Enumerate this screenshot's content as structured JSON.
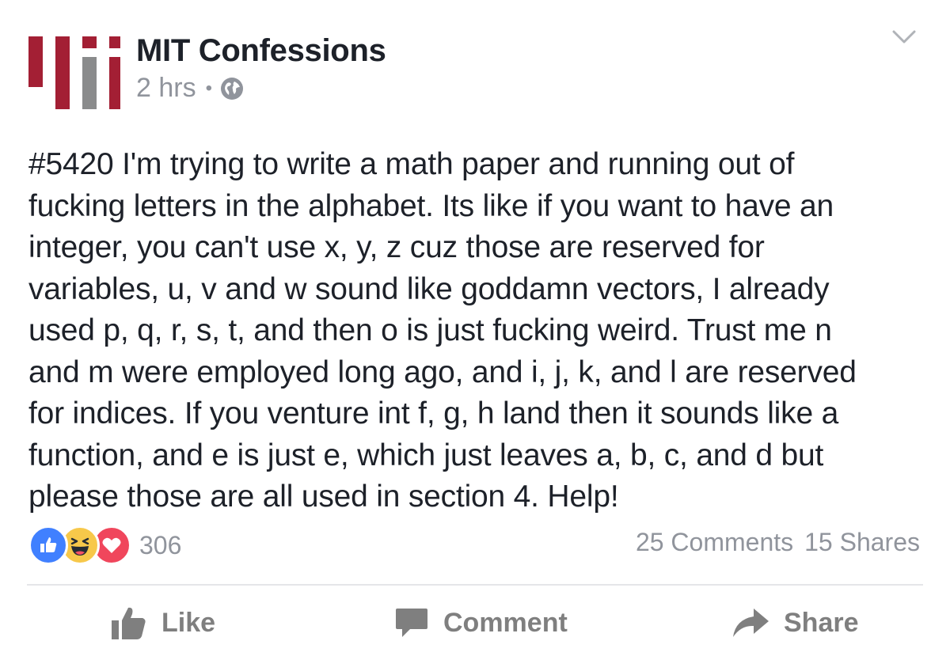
{
  "page": {
    "author": "MIT Confessions",
    "timestamp": "2 hrs",
    "separator": "•",
    "privacy_icon": "globe-icon",
    "menu_icon": "chevron-down-icon"
  },
  "post": {
    "text": "#5420 I'm trying to write a math paper and running out of\nfucking letters in the alphabet. Its like if you want to have an\ninteger, you can't use x, y, z cuz those are reserved for\nvariables, u, v and w sound like goddamn vectors, I already\nused p, q, r, s, t,  and then o is just fucking weird. Trust me n\nand m were employed long ago, and i, j, k, and l are reserved\nfor indices. If you venture int f, g, h land then it sounds like a\nfunction, and e is just e, which just leaves a, b, c, and d but\nplease those are all used in section 4. Help!"
  },
  "reactions": {
    "count": "306",
    "icons": [
      "like-reaction-icon",
      "haha-reaction-icon",
      "love-reaction-icon"
    ],
    "colors": {
      "like": "#4080ff",
      "haha": "#f7c84a",
      "love": "#f0465c"
    }
  },
  "stats": {
    "comments": "25 Comments",
    "shares": "15 Shares"
  },
  "actions": {
    "like": "Like",
    "comment": "Comment",
    "share": "Share"
  },
  "colors": {
    "brand_red": "#a31f34",
    "brand_gray": "#8a8b8c",
    "text": "#1d2129",
    "meta": "#90949c",
    "action": "#7f7f7f"
  }
}
